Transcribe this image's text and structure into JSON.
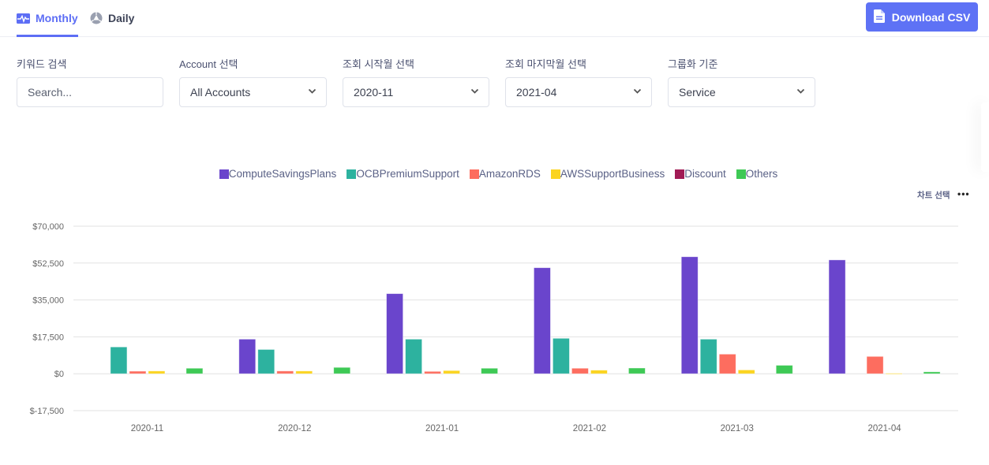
{
  "tabs": [
    {
      "label": "Monthly",
      "icon": "activity-icon",
      "active": true
    },
    {
      "label": "Daily",
      "icon": "pie-icon",
      "active": false
    }
  ],
  "download_button": {
    "label": "Download CSV",
    "icon": "file-icon"
  },
  "filters": {
    "keyword": {
      "label": "키워드 검색",
      "placeholder": "Search...",
      "value": ""
    },
    "account": {
      "label": "Account 선택",
      "value": "All Accounts"
    },
    "start_month": {
      "label": "조회 시작월 선택",
      "value": "2020-11"
    },
    "end_month": {
      "label": "조회 마지막월 선택",
      "value": "2021-04"
    },
    "group_by": {
      "label": "그룹화 기준",
      "value": "Service"
    }
  },
  "chart_controls": {
    "select_label": "차트 선택",
    "more_label": "•••"
  },
  "colors": {
    "accent": "#5e72f5",
    "grid": "#e2e2e2"
  },
  "chart_data": {
    "type": "bar",
    "title": "",
    "xlabel": "",
    "ylabel": "",
    "ylim": [
      -17500,
      70000
    ],
    "yticks": [
      -17500,
      0,
      17500,
      35000,
      52500,
      70000
    ],
    "ytick_labels": [
      "$-17,500",
      "$0",
      "$17,500",
      "$35,000",
      "$52,500",
      "$70,000"
    ],
    "grid": true,
    "legend_position": "top-center",
    "categories": [
      "2020-11",
      "2020-12",
      "2021-01",
      "2021-02",
      "2021-03",
      "2021-04"
    ],
    "series": [
      {
        "name": "ComputeSavingsPlans",
        "color": "#6a45cc",
        "values": [
          0,
          16400,
          38000,
          50300,
          55500,
          54000
        ]
      },
      {
        "name": "OCBPremiumSupport",
        "color": "#2db29f",
        "values": [
          12700,
          11500,
          16400,
          16800,
          16400,
          0
        ]
      },
      {
        "name": "AmazonRDS",
        "color": "#fd6d5f",
        "values": [
          1200,
          1300,
          1100,
          2600,
          9300,
          8200
        ]
      },
      {
        "name": "AWSSupportBusiness",
        "color": "#fbd420",
        "values": [
          1300,
          1300,
          1500,
          1700,
          1800,
          200
        ]
      },
      {
        "name": "Discount",
        "color": "#a11b55",
        "values": [
          0,
          0,
          0,
          0,
          0,
          0
        ]
      },
      {
        "name": "Others",
        "color": "#3ec955",
        "values": [
          2600,
          3000,
          2600,
          2700,
          4000,
          900
        ]
      }
    ]
  }
}
